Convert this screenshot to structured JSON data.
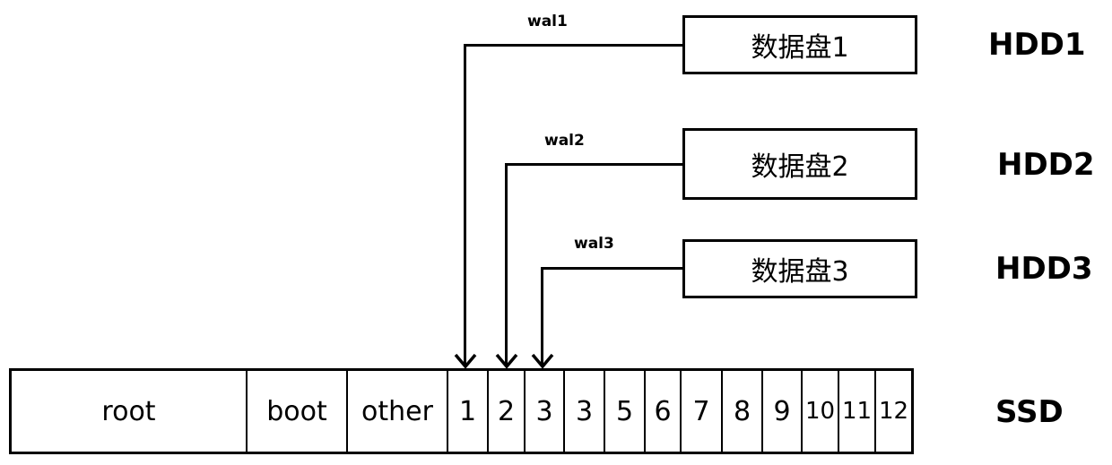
{
  "wal_links": [
    {
      "label": "wal1",
      "target_slot": "1",
      "disk": "数据盘1"
    },
    {
      "label": "wal2",
      "target_slot": "2",
      "disk": "数据盘2"
    },
    {
      "label": "wal3",
      "target_slot": "3",
      "disk": "数据盘3"
    }
  ],
  "data_disks": [
    {
      "label": "数据盘1",
      "device": "HDD1"
    },
    {
      "label": "数据盘2",
      "device": "HDD2"
    },
    {
      "label": "数据盘3",
      "device": "HDD3"
    }
  ],
  "ssd": {
    "label": "SSD",
    "partitions": [
      "root",
      "boot",
      "other",
      "1",
      "2",
      "3",
      "3",
      "5",
      "6",
      "7",
      "8",
      "9",
      "10",
      "11",
      "12"
    ]
  }
}
